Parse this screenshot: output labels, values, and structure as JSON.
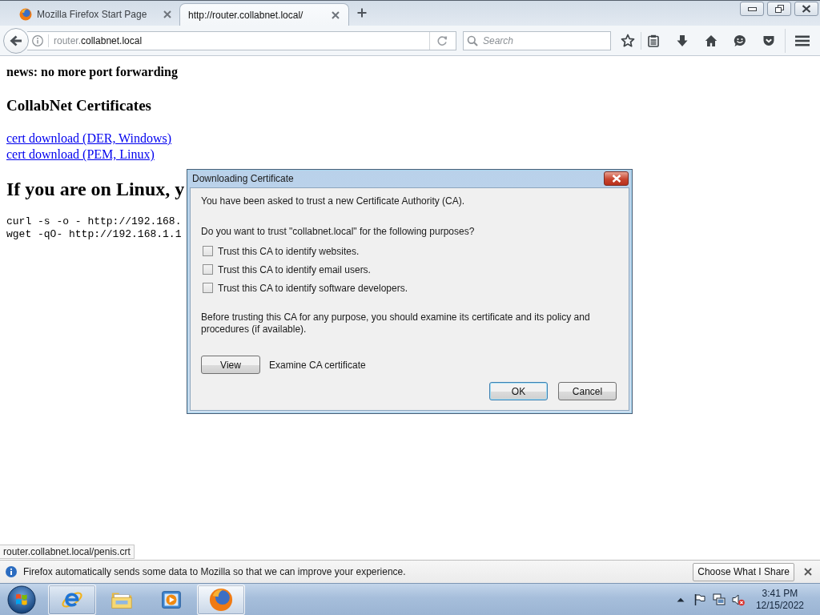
{
  "tabs": [
    {
      "title": "Mozilla Firefox Start Page",
      "kind": "favicon",
      "selected": false
    },
    {
      "title": "http://router.collabnet.local/",
      "kind": "plain",
      "selected": true
    }
  ],
  "address_bar": {
    "host_prefix": "router.",
    "host": "collabnet.local"
  },
  "search": {
    "placeholder": "Search"
  },
  "page": {
    "news": "news: no more port forwarding",
    "heading": "CollabNet Certificates",
    "links": [
      "cert download (DER, Windows)",
      "cert download (PEM, Linux)"
    ],
    "section_heading": "If you are on Linux, y",
    "code_lines": [
      "curl -s -o - http://192.168.",
      "wget -qO- http://192.168.1.1"
    ]
  },
  "dialog": {
    "title": "Downloading Certificate",
    "intro": "You have been asked to trust a new Certificate Authority (CA).",
    "question": "Do you want to trust \"collabnet.local\" for the following purposes?",
    "options": [
      {
        "label": "Trust this CA to identify websites.",
        "checked": false
      },
      {
        "label": "Trust this CA to identify email users.",
        "checked": false
      },
      {
        "label": "Trust this CA to identify software developers.",
        "checked": false
      }
    ],
    "advice": "Before trusting this CA for any purpose, you should examine its certificate and its policy and procedures (if available).",
    "view_button": "View",
    "view_hint": "Examine CA certificate",
    "buttons": [
      {
        "label": "OK",
        "kind": "confirm"
      },
      {
        "label": "Cancel",
        "kind": "cancel"
      }
    ]
  },
  "link_preview": "router.collabnet.local/penis.crt",
  "notification": {
    "message": "Firefox automatically sends some data to Mozilla so that we can improve your experience.",
    "button": "Choose What I Share"
  },
  "taskbar": {
    "apps": [
      {
        "kind": "ebrowser",
        "running": true,
        "selected": false
      },
      {
        "kind": "folders",
        "running": false,
        "selected": false
      },
      {
        "kind": "player",
        "running": false,
        "selected": false
      },
      {
        "kind": "foxbrowser",
        "running": true,
        "selected": true
      }
    ],
    "clock": {
      "time": "3:41 PM",
      "date": "12/15/2022"
    }
  }
}
